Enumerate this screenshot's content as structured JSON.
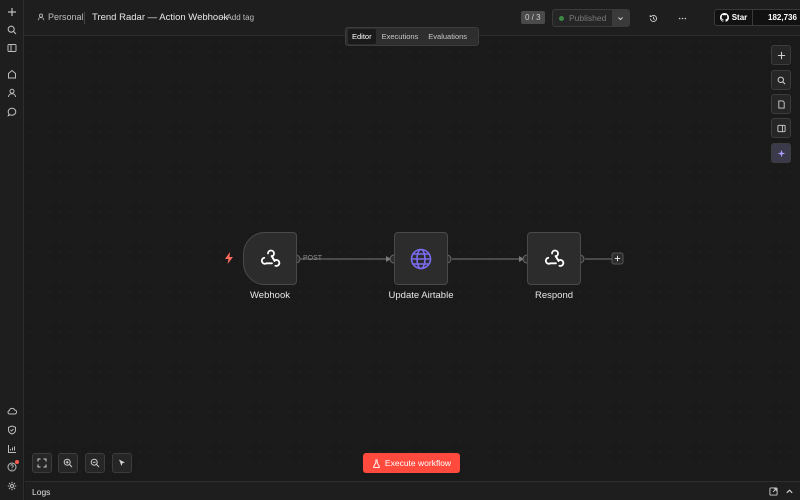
{
  "sidebar": {
    "top_items": [
      {
        "icon": "plus-icon",
        "label": "Create"
      },
      {
        "icon": "search-icon",
        "label": "Search"
      },
      {
        "icon": "sidebar-toggle-icon",
        "label": "Toggle sidebar"
      },
      {
        "icon": "home-icon",
        "label": "Overview"
      },
      {
        "icon": "user-icon",
        "label": "Personal"
      },
      {
        "icon": "chat-icon",
        "label": "Chat"
      }
    ],
    "bottom_items": [
      {
        "icon": "cloud-icon",
        "label": "Cloud"
      },
      {
        "icon": "shield-icon",
        "label": "Admin"
      },
      {
        "icon": "chart-icon",
        "label": "Insights"
      },
      {
        "icon": "help-icon",
        "label": "Help"
      },
      {
        "icon": "settings-icon",
        "label": "Settings"
      }
    ]
  },
  "header": {
    "project": "Personal",
    "workflow_title": "Trend Radar — Action Webhook",
    "add_tag": "+ Add tag",
    "counter": "0 / 3",
    "publish_label": "Published",
    "github_star": "Star",
    "github_count": "182,736"
  },
  "tabs": [
    {
      "label": "Editor",
      "active": true
    },
    {
      "label": "Executions",
      "active": false
    },
    {
      "label": "Evaluations",
      "active": false
    }
  ],
  "nodes": [
    {
      "name": "Webhook",
      "icon": "webhook-icon",
      "trigger": true
    },
    {
      "name": "Update Airtable",
      "icon": "globe-icon",
      "trigger": false
    },
    {
      "name": "Respond",
      "icon": "webhook-icon",
      "trigger": false
    }
  ],
  "connection_label": "POST",
  "execute_button": "Execute workflow",
  "logs_label": "Logs",
  "colors": {
    "accent": "#ff4a3d",
    "globe": "#7c6cf2",
    "published_dot": "#3d8a45",
    "ai_button": "#a99cff"
  }
}
